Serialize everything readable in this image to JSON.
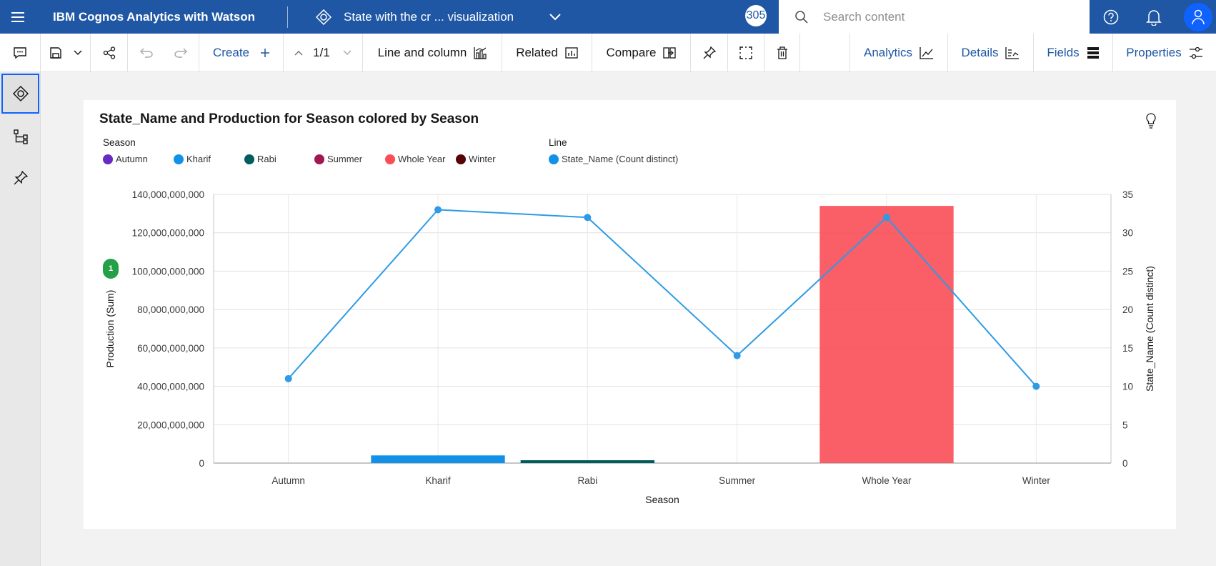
{
  "topbar": {
    "app_title": "IBM Cognos Analytics with Watson",
    "doc_title": "State with the cr ... visualization",
    "badge": "305",
    "search_placeholder": "Search content"
  },
  "toolbar": {
    "create": "Create",
    "page_indicator": "1/1",
    "line_and_column": "Line and column",
    "related": "Related",
    "compare": "Compare",
    "analytics": "Analytics",
    "details": "Details",
    "fields": "Fields",
    "properties": "Properties"
  },
  "colors": {
    "accent": "#1f57a4",
    "autumn": "#6929c4",
    "kharif": "#1192e8",
    "rabi": "#005d5d",
    "summer": "#9f1853",
    "whole_year": "#fa4d56",
    "winter": "#570408",
    "line": "#2d9be6"
  },
  "chart": {
    "title": "State_Name and Production for Season colored by Season",
    "legend_season_title": "Season",
    "legend_line_title": "Line",
    "legend_season": [
      {
        "label": "Autumn",
        "color": "#6929c4"
      },
      {
        "label": "Kharif",
        "color": "#1192e8"
      },
      {
        "label": "Rabi",
        "color": "#005d5d"
      },
      {
        "label": "Summer",
        "color": "#9f1853"
      },
      {
        "label": "Whole Year",
        "color": "#fa4d56"
      },
      {
        "label": "Winter",
        "color": "#570408"
      }
    ],
    "legend_line": [
      {
        "label": "State_Name (Count distinct)",
        "color": "#1192e8"
      }
    ],
    "marker_label": "1"
  },
  "chart_data": {
    "type": "bar",
    "title": "State_Name and Production for Season colored by Season",
    "xlabel": "Season",
    "ylabel": "Production (Sum)",
    "y2label": "State_Name (Count distinct)",
    "categories": [
      "Autumn",
      "Kharif",
      "Rabi",
      "Summer",
      "Whole Year",
      "Winter"
    ],
    "series": [
      {
        "name": "Production (Sum)",
        "kind": "bar",
        "axis": "left",
        "values": [
          0,
          4000000000,
          1500000000,
          0,
          134000000000,
          0
        ],
        "colors": [
          "#6929c4",
          "#1192e8",
          "#005d5d",
          "#9f1853",
          "#fa4d56",
          "#570408"
        ]
      },
      {
        "name": "State_Name (Count distinct)",
        "kind": "line",
        "axis": "right",
        "values": [
          11,
          33,
          32,
          14,
          32,
          10
        ],
        "color": "#2d9be6"
      }
    ],
    "ylim": [
      0,
      140000000000
    ],
    "y2lim": [
      0,
      35
    ],
    "yticks": [
      "0",
      "20,000,000,000",
      "40,000,000,000",
      "60,000,000,000",
      "80,000,000,000",
      "100,000,000,000",
      "120,000,000,000",
      "140,000,000,000"
    ],
    "y2ticks": [
      "0",
      "5",
      "10",
      "15",
      "20",
      "25",
      "30",
      "35"
    ],
    "grid": true,
    "legend_position": "top-left"
  }
}
